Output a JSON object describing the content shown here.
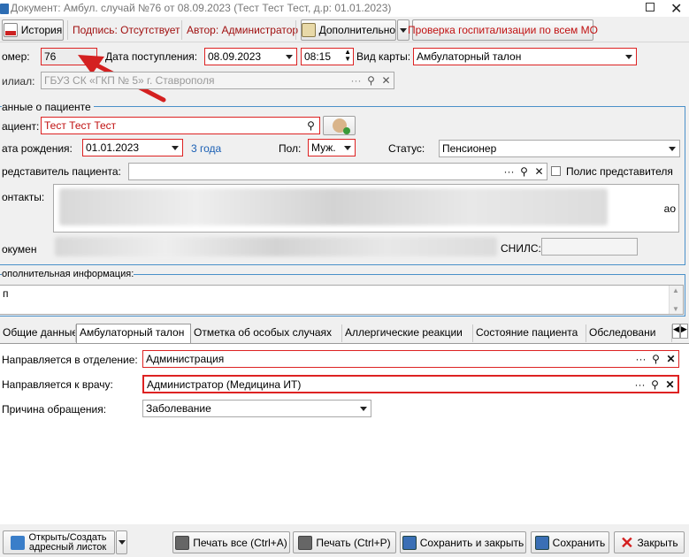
{
  "window": {
    "title": "Документ: Амбул. случай №76 от 08.09.2023 (Тест Тест Тест, д.р: 01.01.2023)"
  },
  "toolbar": {
    "history_label": "История",
    "sign_status": "Подпись: Отсутствует",
    "author": "Автор: Администратор",
    "more_label": "Дополнительно",
    "hospital_check": "Проверка госпитализации по всем МО"
  },
  "header": {
    "number_label": "омер:",
    "number_value": "76",
    "arrival_label": "Дата поступления:",
    "arrival_date": "08.09.2023",
    "arrival_time": "08:15",
    "card_type_label": "Вид карты:",
    "card_type_value": "Амбулаторный талон",
    "branch_label": "илиал:",
    "branch_value": "ГБУЗ СК «ГКП № 5» г. Ставрополя"
  },
  "patient": {
    "group_title": "анные о пациенте",
    "patient_label": "ациент:",
    "patient_value": "Тест Тест Тест",
    "birth_label": "ата рождения:",
    "birth_value": "01.01.2023",
    "age": "3 года",
    "sex_label": "Пол:",
    "sex_value": "Муж.",
    "status_label": "Статус:",
    "status_value": "Пенсионер",
    "rep_label": "редставитель пациента:",
    "rep_policy_label": "Полис представителя",
    "contacts_label": "онтакты:",
    "contacts_tail": "ао",
    "document_label": "окумен",
    "snils_label": "СНИЛС:"
  },
  "additional": {
    "title": "ополнительная информация:",
    "text": "п"
  },
  "tabs": [
    "Общие данные",
    "Амбулаторный талон",
    "Отметка об особых случаях",
    "Аллергические реакции",
    "Состояние пациента",
    "Обследовани"
  ],
  "talon": {
    "dept_label": "Направляется в отделение:",
    "dept_value": "Администрация",
    "doctor_label": "Направляется к врачу:",
    "doctor_value": "Администратор (Медицина ИТ)",
    "reason_label": "Причина обращения:",
    "reason_value": "Заболевание"
  },
  "footer": {
    "address_sheet": "Открыть/Создать\nадресный листок",
    "print_all": "Печать все (Ctrl+A)",
    "print": "Печать (Ctrl+P)",
    "save_close": "Сохранить и закрыть",
    "save": "Сохранить",
    "close": "Закрыть"
  },
  "colors": {
    "required_border": "#d22222",
    "accent": "#2d6db3",
    "arrow": "#d42020",
    "link": "#1a5fb4"
  }
}
